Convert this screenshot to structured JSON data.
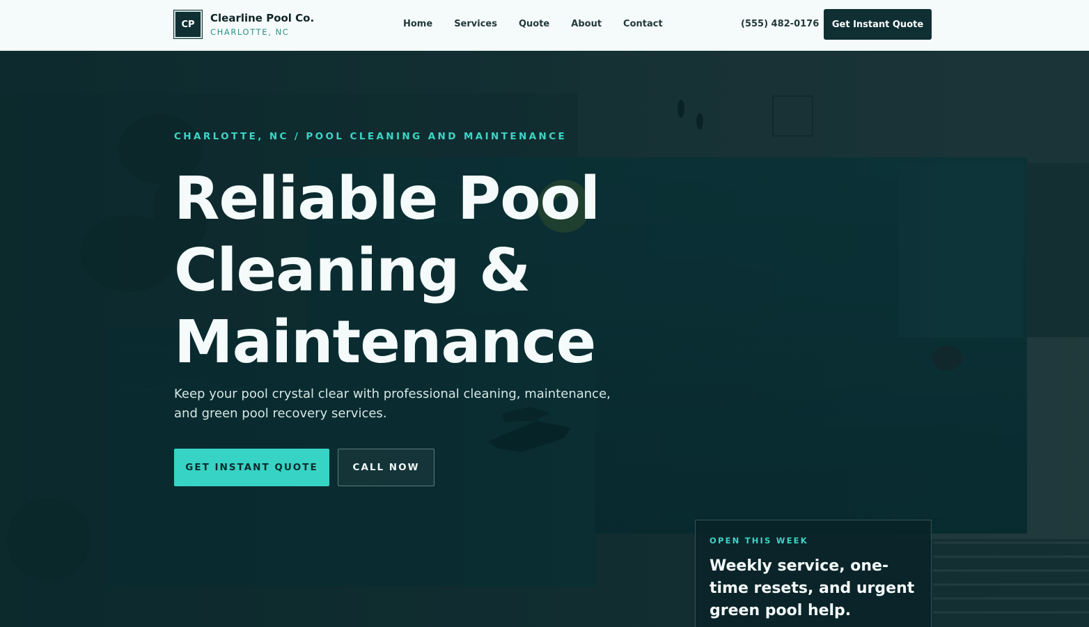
{
  "header": {
    "logo_badge": "CP",
    "brand_name": "Clearline Pool Co.",
    "brand_location": "CHARLOTTE, NC",
    "nav": [
      {
        "label": "Home"
      },
      {
        "label": "Services"
      },
      {
        "label": "Quote"
      },
      {
        "label": "About"
      },
      {
        "label": "Contact"
      }
    ],
    "phone": "(555) 482-0176",
    "cta_label": "Get Instant Quote"
  },
  "hero": {
    "eyebrow": "CHARLOTTE, NC / POOL CLEANING AND MAINTENANCE",
    "headline": "Reliable Pool Cleaning & Maintenance",
    "subtext": "Keep your pool crystal clear with professional cleaning, maintenance, and green pool recovery services.",
    "primary_button": "GET INSTANT QUOTE",
    "secondary_button": "CALL NOW"
  },
  "card": {
    "label": "OPEN THIS WEEK",
    "text": "Weekly service, one-time resets, and urgent green pool help."
  },
  "colors": {
    "accent": "#37d3c4",
    "dark": "#0f2f33",
    "header_bg": "#f5fbfa"
  },
  "icons": [
    "pool-aerial-background-image"
  ]
}
